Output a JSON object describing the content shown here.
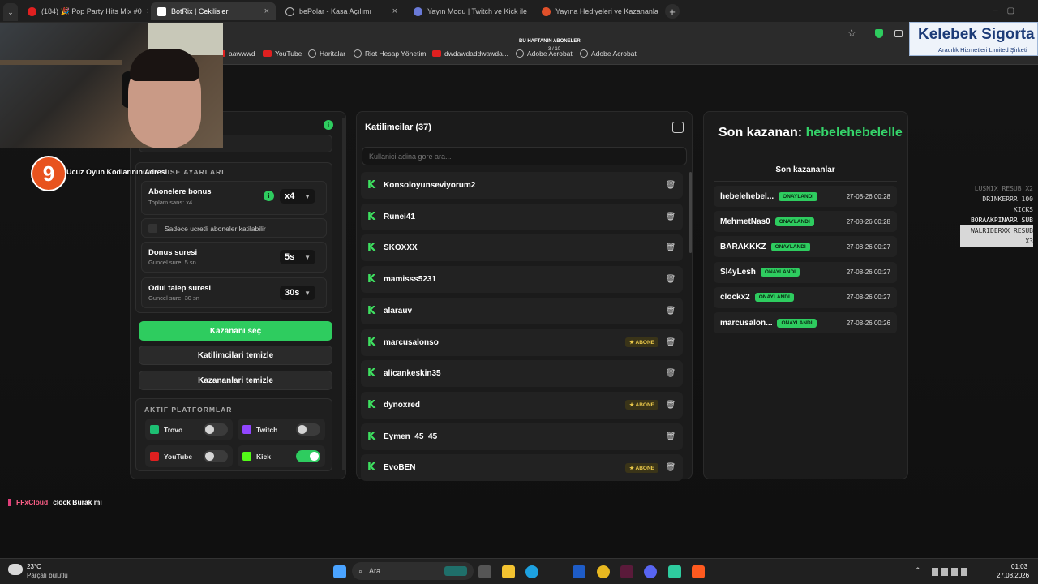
{
  "browser": {
    "tabs": [
      {
        "label": "(184) 🎉 Pop Party Hits Mix #0",
        "active": false,
        "icon": "youtube-icon"
      },
      {
        "label": "BotRix | Cekilisler",
        "active": true,
        "icon": "botrix-icon"
      },
      {
        "label": "bePolar - Kasa Açılımı",
        "active": false,
        "icon": "globe-icon"
      },
      {
        "label": "Yayın Modu | Twitch ve Kick ile",
        "active": false,
        "icon": "yayin-icon"
      },
      {
        "label": "Yayına Hediyeleri ve Kazananla",
        "active": false,
        "icon": "p-icon"
      }
    ],
    "bookmarks": [
      "aawwwd",
      "YouTube",
      "Haritalar",
      "Riot Hesap Yönetimi",
      "dwdawdaddwawda...",
      "Adobe Acrobat",
      "Adobe Acrobat"
    ]
  },
  "overlay": {
    "abone_title": "BU HAFTANIN ABONELER",
    "abone_count": "3 / 10",
    "ucuz_text": "Ucuz Oyun Kodlarının Adresi",
    "sigorta_title": "Kelebek Sigorta",
    "sigorta_sub": "Aracılık Hizmetleri Limited Şirketi",
    "events": [
      "LUSNIX RESUB X2",
      "DRINKERRR 100 KICKS",
      "BORAAKPINARR SUB",
      "WALRIDERXX RESUB X3"
    ],
    "chat_user": "FFxCloud",
    "chat_message": "clock Burak mı"
  },
  "settings": {
    "section_title": "CEKILISE AYARLARI",
    "bonus_label": "Abonelere bonus",
    "bonus_sub": "Toplam sans: x4",
    "bonus_value": "x4",
    "paid_only_label": "Sadece ucretli aboneler katilabilir",
    "donus_label": "Donus suresi",
    "donus_sub": "Guncel sure: 5 sn",
    "donus_value": "5s",
    "odul_label": "Odul talep suresi",
    "odul_sub": "Guncel sure: 30 sn",
    "odul_value": "30s",
    "pick_winner": "Kazananı seç",
    "clear_participants": "Katilimcilari temizle",
    "clear_winners": "Kazananlari temizle",
    "platforms_title": "AKTIF PLATFORMLAR",
    "platforms": [
      {
        "name": "Trovo",
        "on": false,
        "color": "#1dbf73"
      },
      {
        "name": "Twitch",
        "on": false,
        "color": "#9146ff"
      },
      {
        "name": "YouTube",
        "on": false,
        "color": "#e02020"
      },
      {
        "name": "Kick",
        "on": true,
        "color": "#53fc18"
      }
    ]
  },
  "participants": {
    "title": "Katilimcilar (37)",
    "search_placeholder": "Kullanici adina gore ara...",
    "abone_label": "ABONE",
    "list": [
      {
        "name": "Konsoloyunseviyorum2",
        "abone": false
      },
      {
        "name": "Runei41",
        "abone": false
      },
      {
        "name": "SKOXXX",
        "abone": false
      },
      {
        "name": "mamisss5231",
        "abone": false
      },
      {
        "name": "alarauv",
        "abone": false
      },
      {
        "name": "marcusalonso",
        "abone": true
      },
      {
        "name": "alicankeskin35",
        "abone": false
      },
      {
        "name": "dynoxred",
        "abone": true
      },
      {
        "name": "Eymen_45_45",
        "abone": false
      },
      {
        "name": "EvoBEN",
        "abone": true
      }
    ]
  },
  "winners": {
    "last_label": "Son kazanan:",
    "last_name": "hebelehebelelle",
    "list_title": "Son kazananlar",
    "badge": "ONAYLANDI",
    "list": [
      {
        "name": "hebelehebel...",
        "date": "27-08-26 00:28"
      },
      {
        "name": "MehmetNas0",
        "date": "27-08-26 00:28"
      },
      {
        "name": "BARAKKKZ",
        "date": "27-08-26 00:27"
      },
      {
        "name": "Sl4yLesh",
        "date": "27-08-26 00:27"
      },
      {
        "name": "clockx2",
        "date": "27-08-26 00:27"
      },
      {
        "name": "marcusalon...",
        "date": "27-08-26 00:26"
      }
    ]
  },
  "taskbar": {
    "weather_temp": "23°C",
    "weather_desc": "Parçalı bulutlu",
    "search_label": "Ara",
    "time": "01:03",
    "date": "27.08.2026"
  },
  "colors": {
    "accent": "#2ecc5f",
    "winner_name": "#35d46a"
  }
}
